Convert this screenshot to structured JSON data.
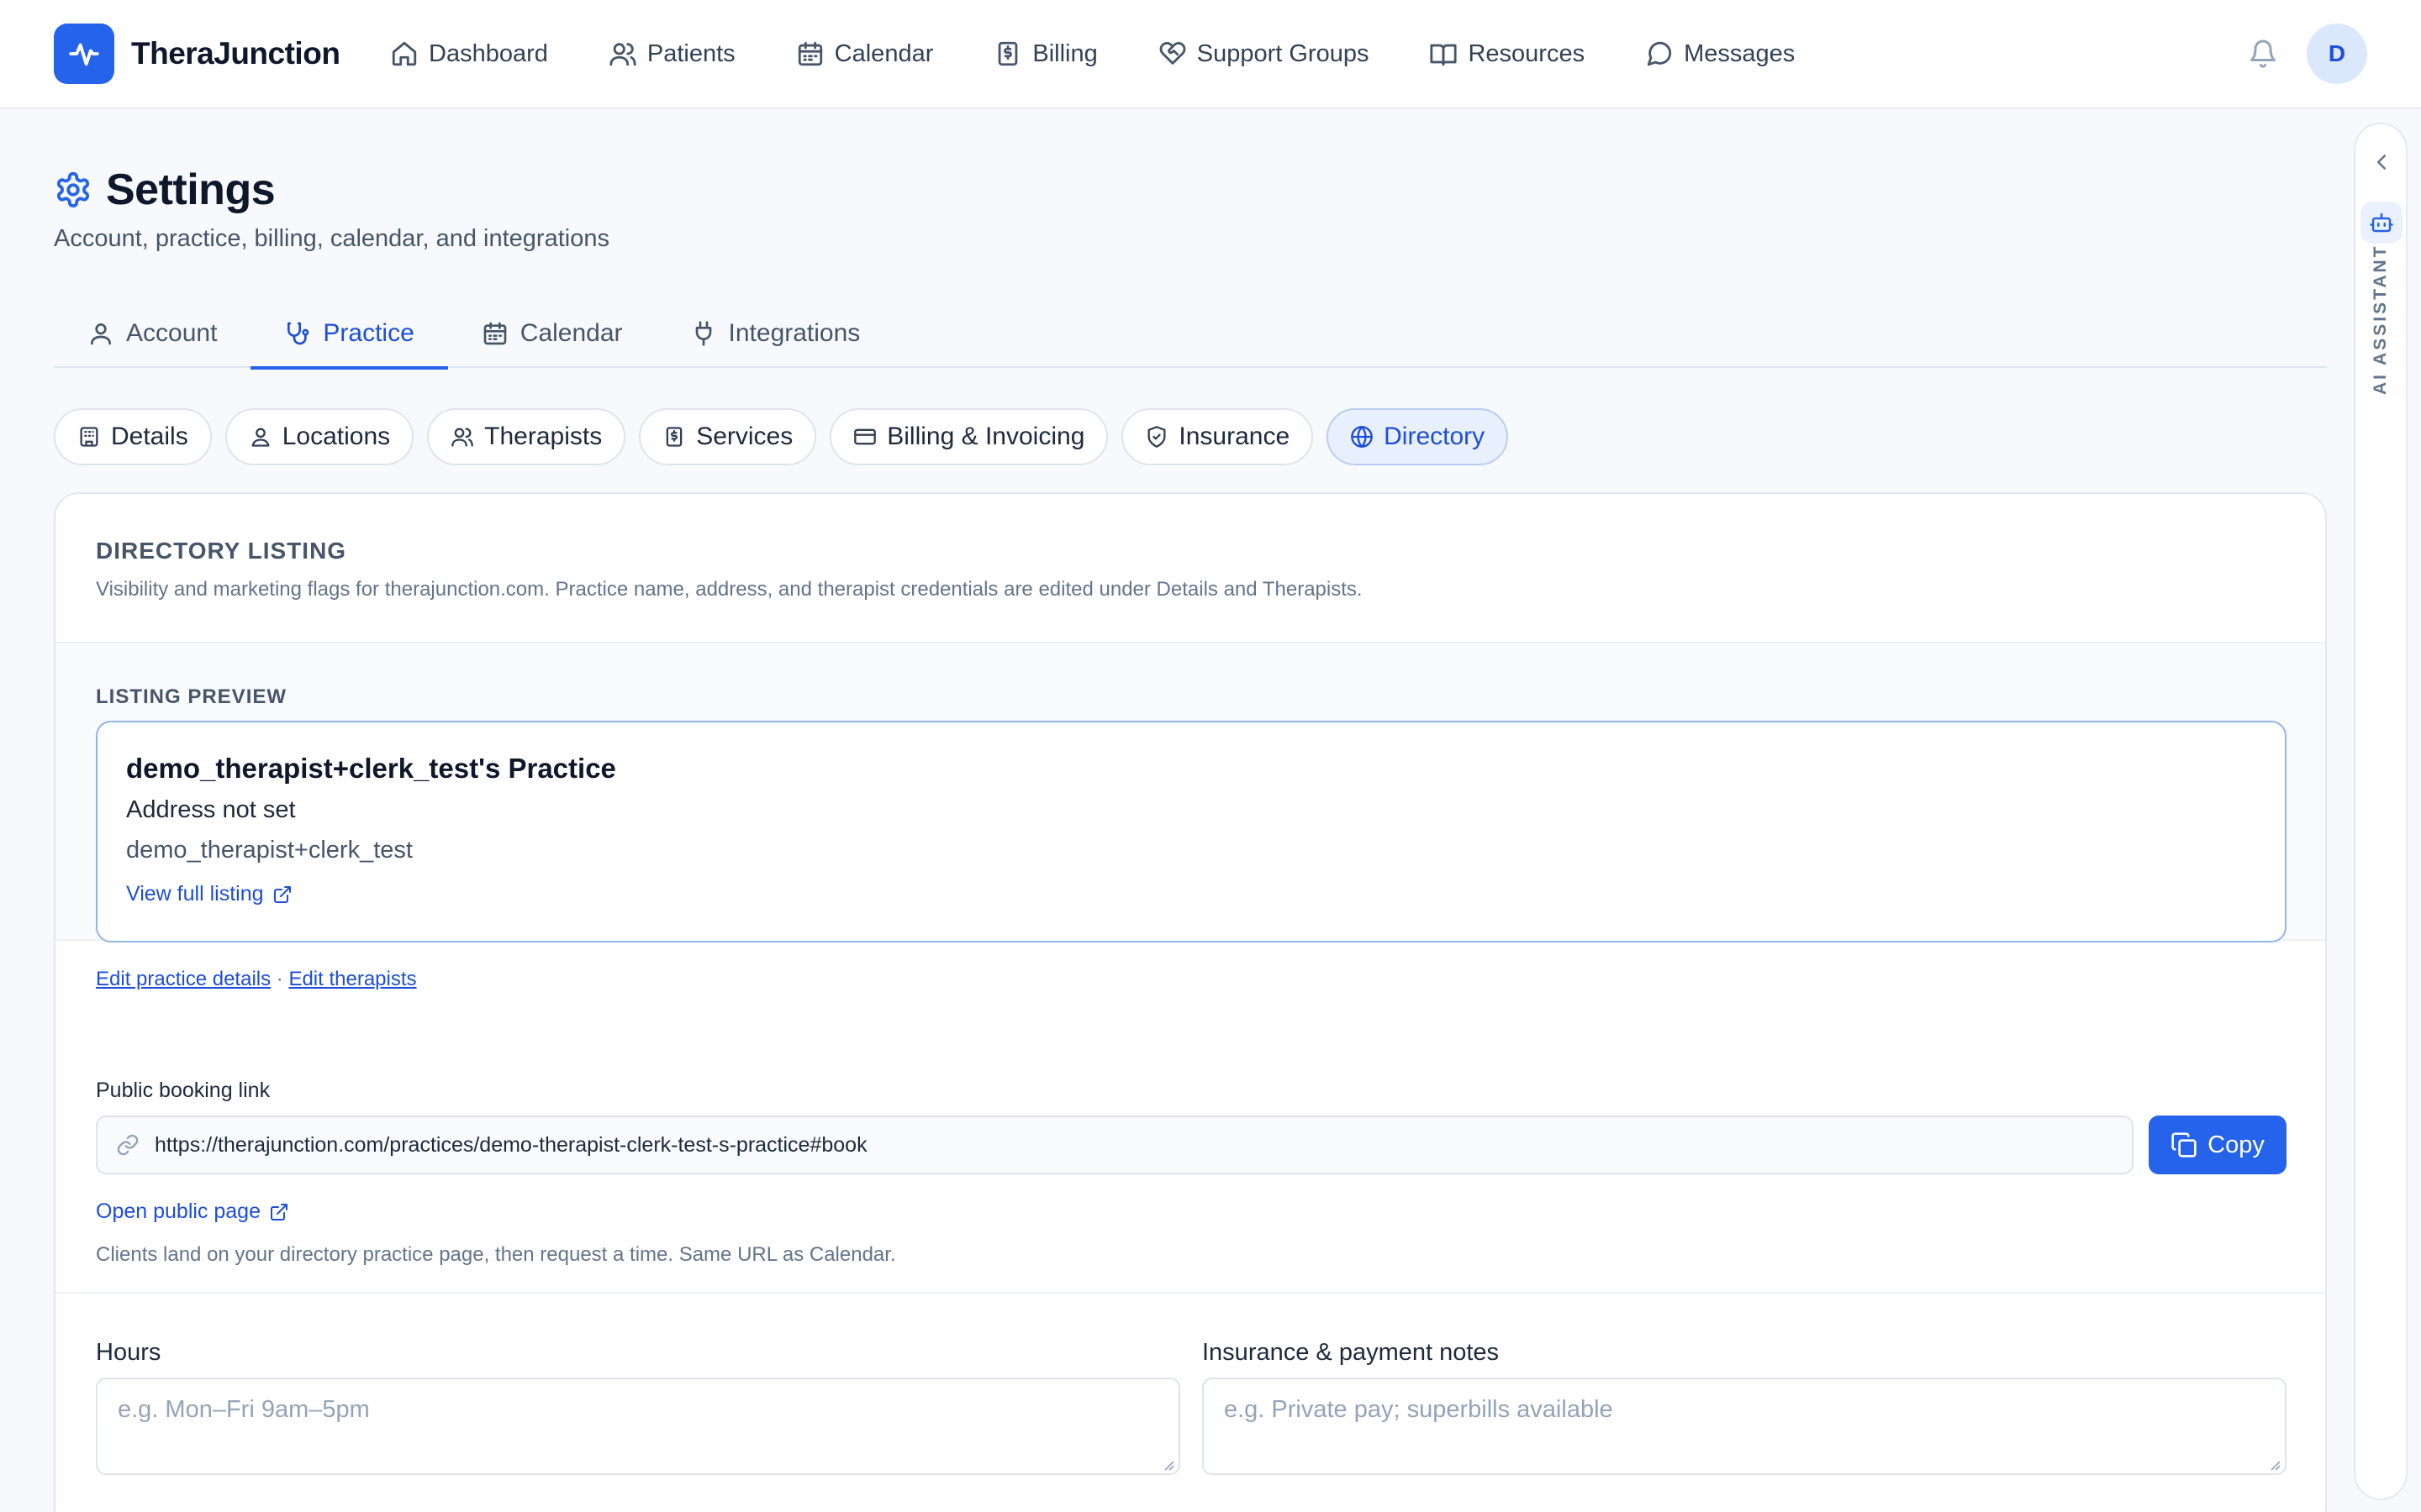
{
  "app": {
    "name": "TheraJunction",
    "avatar_initial": "D"
  },
  "nav": [
    {
      "label": "Dashboard",
      "icon": "home-icon"
    },
    {
      "label": "Patients",
      "icon": "users-icon"
    },
    {
      "label": "Calendar",
      "icon": "calendar-icon"
    },
    {
      "label": "Billing",
      "icon": "receipt-icon"
    },
    {
      "label": "Support Groups",
      "icon": "heart-handshake-icon"
    },
    {
      "label": "Resources",
      "icon": "book-open-icon"
    },
    {
      "label": "Messages",
      "icon": "message-circle-icon"
    }
  ],
  "ai_panel": {
    "label": "AI ASSISTANT"
  },
  "header": {
    "title": "Settings",
    "subtitle": "Account, practice, billing, calendar, and integrations"
  },
  "tabs": [
    {
      "label": "Account",
      "active": false
    },
    {
      "label": "Practice",
      "active": true
    },
    {
      "label": "Calendar",
      "active": false
    },
    {
      "label": "Integrations",
      "active": false
    }
  ],
  "subtabs": [
    {
      "label": "Details"
    },
    {
      "label": "Locations"
    },
    {
      "label": "Therapists"
    },
    {
      "label": "Services"
    },
    {
      "label": "Billing & Invoicing"
    },
    {
      "label": "Insurance"
    },
    {
      "label": "Directory",
      "active": true
    }
  ],
  "directory": {
    "title": "DIRECTORY LISTING",
    "description": "Visibility and marketing flags for therajunction.com. Practice name, address, and therapist credentials are edited under Details and Therapists."
  },
  "preview": {
    "label": "LISTING PREVIEW",
    "practice_name": "demo_therapist+clerk_test's Practice",
    "address": "Address not set",
    "owner": "demo_therapist+clerk_test",
    "view_link": "View full listing",
    "edit_details_link": "Edit practice details",
    "separator": "·",
    "edit_therapists_link": "Edit therapists"
  },
  "booking": {
    "label": "Public booking link",
    "url": "https://therajunction.com/practices/demo-therapist-clerk-test-s-practice#book",
    "copy_label": "Copy",
    "open_link": "Open public page",
    "help": "Clients land on your directory practice page, then request a time. Same URL as Calendar."
  },
  "fields": {
    "hours_label": "Hours",
    "hours_placeholder": "e.g. Mon–Fri 9am–5pm",
    "insurance_label": "Insurance & payment notes",
    "insurance_placeholder": "e.g. Private pay; superbills available"
  },
  "colors": {
    "accent": "#2563eb",
    "text": "#0f172a",
    "muted": "#64748b"
  }
}
